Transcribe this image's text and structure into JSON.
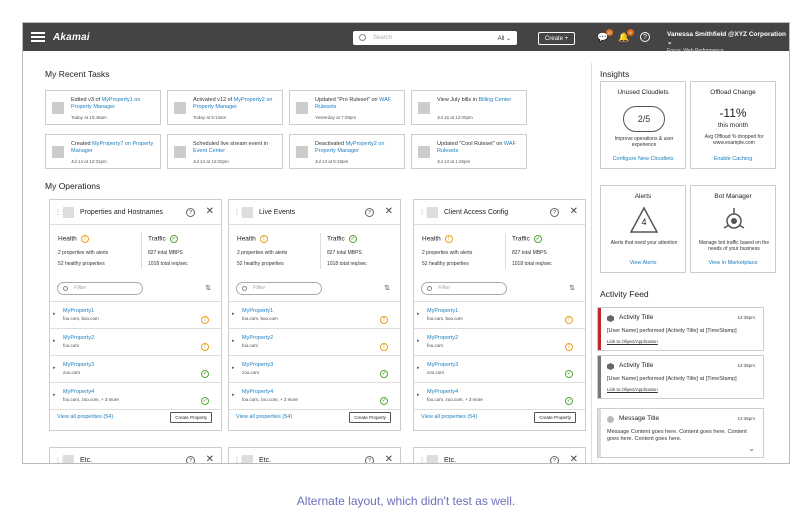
{
  "header": {
    "logo": "Akamai",
    "search_placeholder": "Search",
    "search_scope": "All",
    "create_label": "Create +",
    "notif_count_1": "12",
    "notif_count_2": "4",
    "help": "?",
    "user_name": "Vanessa Smithfield @XYZ Corporation",
    "user_focus": "Focus: Web Performance"
  },
  "recent": {
    "title": "My Recent Tasks",
    "tasks": [
      {
        "pre": "Edited v3 of ",
        "link": "MyProperty1 on Property Manager",
        "post": "",
        "time": "Today at 10:46am"
      },
      {
        "pre": "Activated v12 of ",
        "link": "MyProperty2 on Property Manager",
        "post": "",
        "time": "Today at 9:13am"
      },
      {
        "pre": "Updated \"Pro Ruleset\" on ",
        "link": "WAF Rulesets",
        "post": "",
        "time": "Yesterday at 7:29pm"
      },
      {
        "pre": "View July bills in ",
        "link": "Billing Center",
        "post": "",
        "time": "Jul 15 at 12:00pm"
      },
      {
        "pre": "Created ",
        "link": "MyProperty7 on Property Manager",
        "post": "",
        "time": "Jul 14 at 12:31pm"
      },
      {
        "pre": "Scheduled live stream event in ",
        "link": "Event Center",
        "post": "",
        "time": "Jul 14 at 12:02pm"
      },
      {
        "pre": "Deactivated ",
        "link": "MyProperty2 on Property Manager",
        "post": "",
        "time": "Jul 13 at 5:19pm"
      },
      {
        "pre": "Updated \"Cool Ruleset\" on ",
        "link": "WAF Rulesets",
        "post": "",
        "time": "Jul 13 at 1:26pm"
      }
    ]
  },
  "ops": {
    "title": "My Operations",
    "cards": [
      {
        "title": "Properties and Hostnames",
        "health": "Health",
        "traffic": "Traffic",
        "h1": "2 properties with alerts",
        "h2": "52 healthy properties",
        "t1": "827 total MBPS",
        "t2": "1018 total req/sec",
        "filter": "Filter",
        "view_all": "View all properties (54)",
        "create": "Create Property",
        "rows": [
          {
            "name": "MyProperty1",
            "domains": "foo.com, boo.com",
            "status": "warn"
          },
          {
            "name": "MyProperty2",
            "domains": "foo.com",
            "status": "warn"
          },
          {
            "name": "MyProperty3",
            "domains": "zoo.com",
            "status": "ok"
          },
          {
            "name": "MyProperty4",
            "domains": "foo.com, zoo.com, + 3 more",
            "status": "ok"
          }
        ]
      },
      {
        "title": "Live Events",
        "health": "Health",
        "traffic": "Traffic",
        "h1": "2 properties with alerts",
        "h2": "52 healthy properties",
        "t1": "827 total MBPS",
        "t2": "1018 total req/sec",
        "filter": "Filter",
        "view_all": "View all properties (54)",
        "create": "Create Property",
        "rows": [
          {
            "name": "MyProperty1",
            "domains": "foo.com, boo.com",
            "status": "warn"
          },
          {
            "name": "MyProperty2",
            "domains": "foo.com",
            "status": "warn"
          },
          {
            "name": "MyProperty3",
            "domains": "zoo.com",
            "status": "ok"
          },
          {
            "name": "MyProperty4",
            "domains": "foo.com, zoo.com, + 3 more",
            "status": "ok"
          }
        ]
      },
      {
        "title": "Client Access Config",
        "health": "Health",
        "traffic": "Traffic",
        "h1": "2 properties with alerts",
        "h2": "52 healthy properties",
        "t1": "827 total MBPS",
        "t2": "1018 total req/sec",
        "filter": "Filter",
        "view_all": "View all properties (54)",
        "create": "Create Property",
        "rows": [
          {
            "name": "MyProperty1",
            "domains": "foo.com, boo.com",
            "status": "warn"
          },
          {
            "name": "MyProperty2",
            "domains": "foo.com",
            "status": "warn"
          },
          {
            "name": "MyProperty3",
            "domains": "zoo.com",
            "status": "ok"
          },
          {
            "name": "MyProperty4",
            "domains": "foo.com, zoo.com, + 3 more",
            "status": "ok"
          }
        ]
      }
    ],
    "etc": [
      "Etc.",
      "Etc.",
      "Etc."
    ]
  },
  "insights": {
    "title": "Insights",
    "cards": [
      {
        "title": "Unused Cloudlets",
        "value": "2/5",
        "desc": "Improve operations & user experience",
        "link": "Configure New Cloudlets"
      },
      {
        "title": "Offload Change",
        "value": "-11%",
        "value2": "this month",
        "desc": "Avg Offload % dropped for www.example.com",
        "link": "Enable Caching"
      },
      {
        "title": "Alerts",
        "value": "4",
        "desc": "Alerts that need your attention",
        "link": "View Alerts"
      },
      {
        "title": "Bot Manager",
        "desc": "Manage bot traffic based on the needs of your business",
        "link": "View in Marketplace"
      }
    ]
  },
  "feed": {
    "title": "Activity Feed",
    "items": [
      {
        "title": "Activity Title",
        "time": "12:38pm",
        "body": "[User Name] performed [Activity Title] at [TimeStamp]",
        "link": "Link to Object/Application",
        "color": "#c0282d"
      },
      {
        "title": "Activity Title",
        "time": "12:38pm",
        "body": "[User Name] performed [Activity Title] at [TimeStamp]",
        "link": "Link to Object/Application",
        "color": "#777777"
      },
      {
        "title": "Message Title",
        "time": "12:38pm",
        "body": "Message Content goes here. Content goes here. Content goes here. Content goes here.",
        "link": "",
        "color": "#dddddd"
      }
    ]
  },
  "caption": "Alternate layout, which didn't test as well."
}
